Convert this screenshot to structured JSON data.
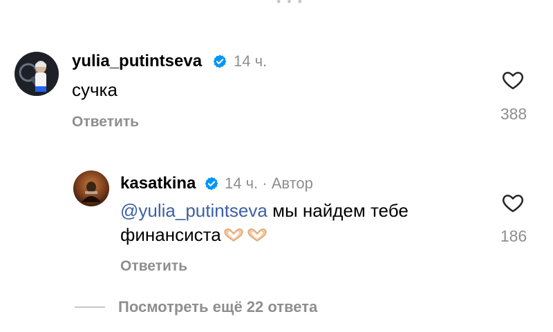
{
  "thread_top_fragment": "• • •",
  "comment": {
    "username": "yulia_putintseva",
    "time": "14 ч.",
    "text": "сучка",
    "reply_label": "Ответить",
    "like_count": "388"
  },
  "reply": {
    "username": "kasatkina",
    "meta": "14 ч. · Автор",
    "mention": "@yulia_putintseva",
    "text_line1_rest": " мы найдем тебе",
    "text_line2": "финансиста",
    "emojis": [
      "heart-hands-emoji",
      "heart-hands-emoji"
    ],
    "reply_label": "Ответить",
    "like_count": "186"
  },
  "more_replies_label": "Посмотреть ещё 22 ответа",
  "colors": {
    "verified": "#0095f6",
    "mention": "#3c5fa6",
    "secondary_text": "#8e8e8e"
  },
  "icons": {
    "verified": "verified-badge-icon",
    "like": "heart-outline-icon"
  }
}
